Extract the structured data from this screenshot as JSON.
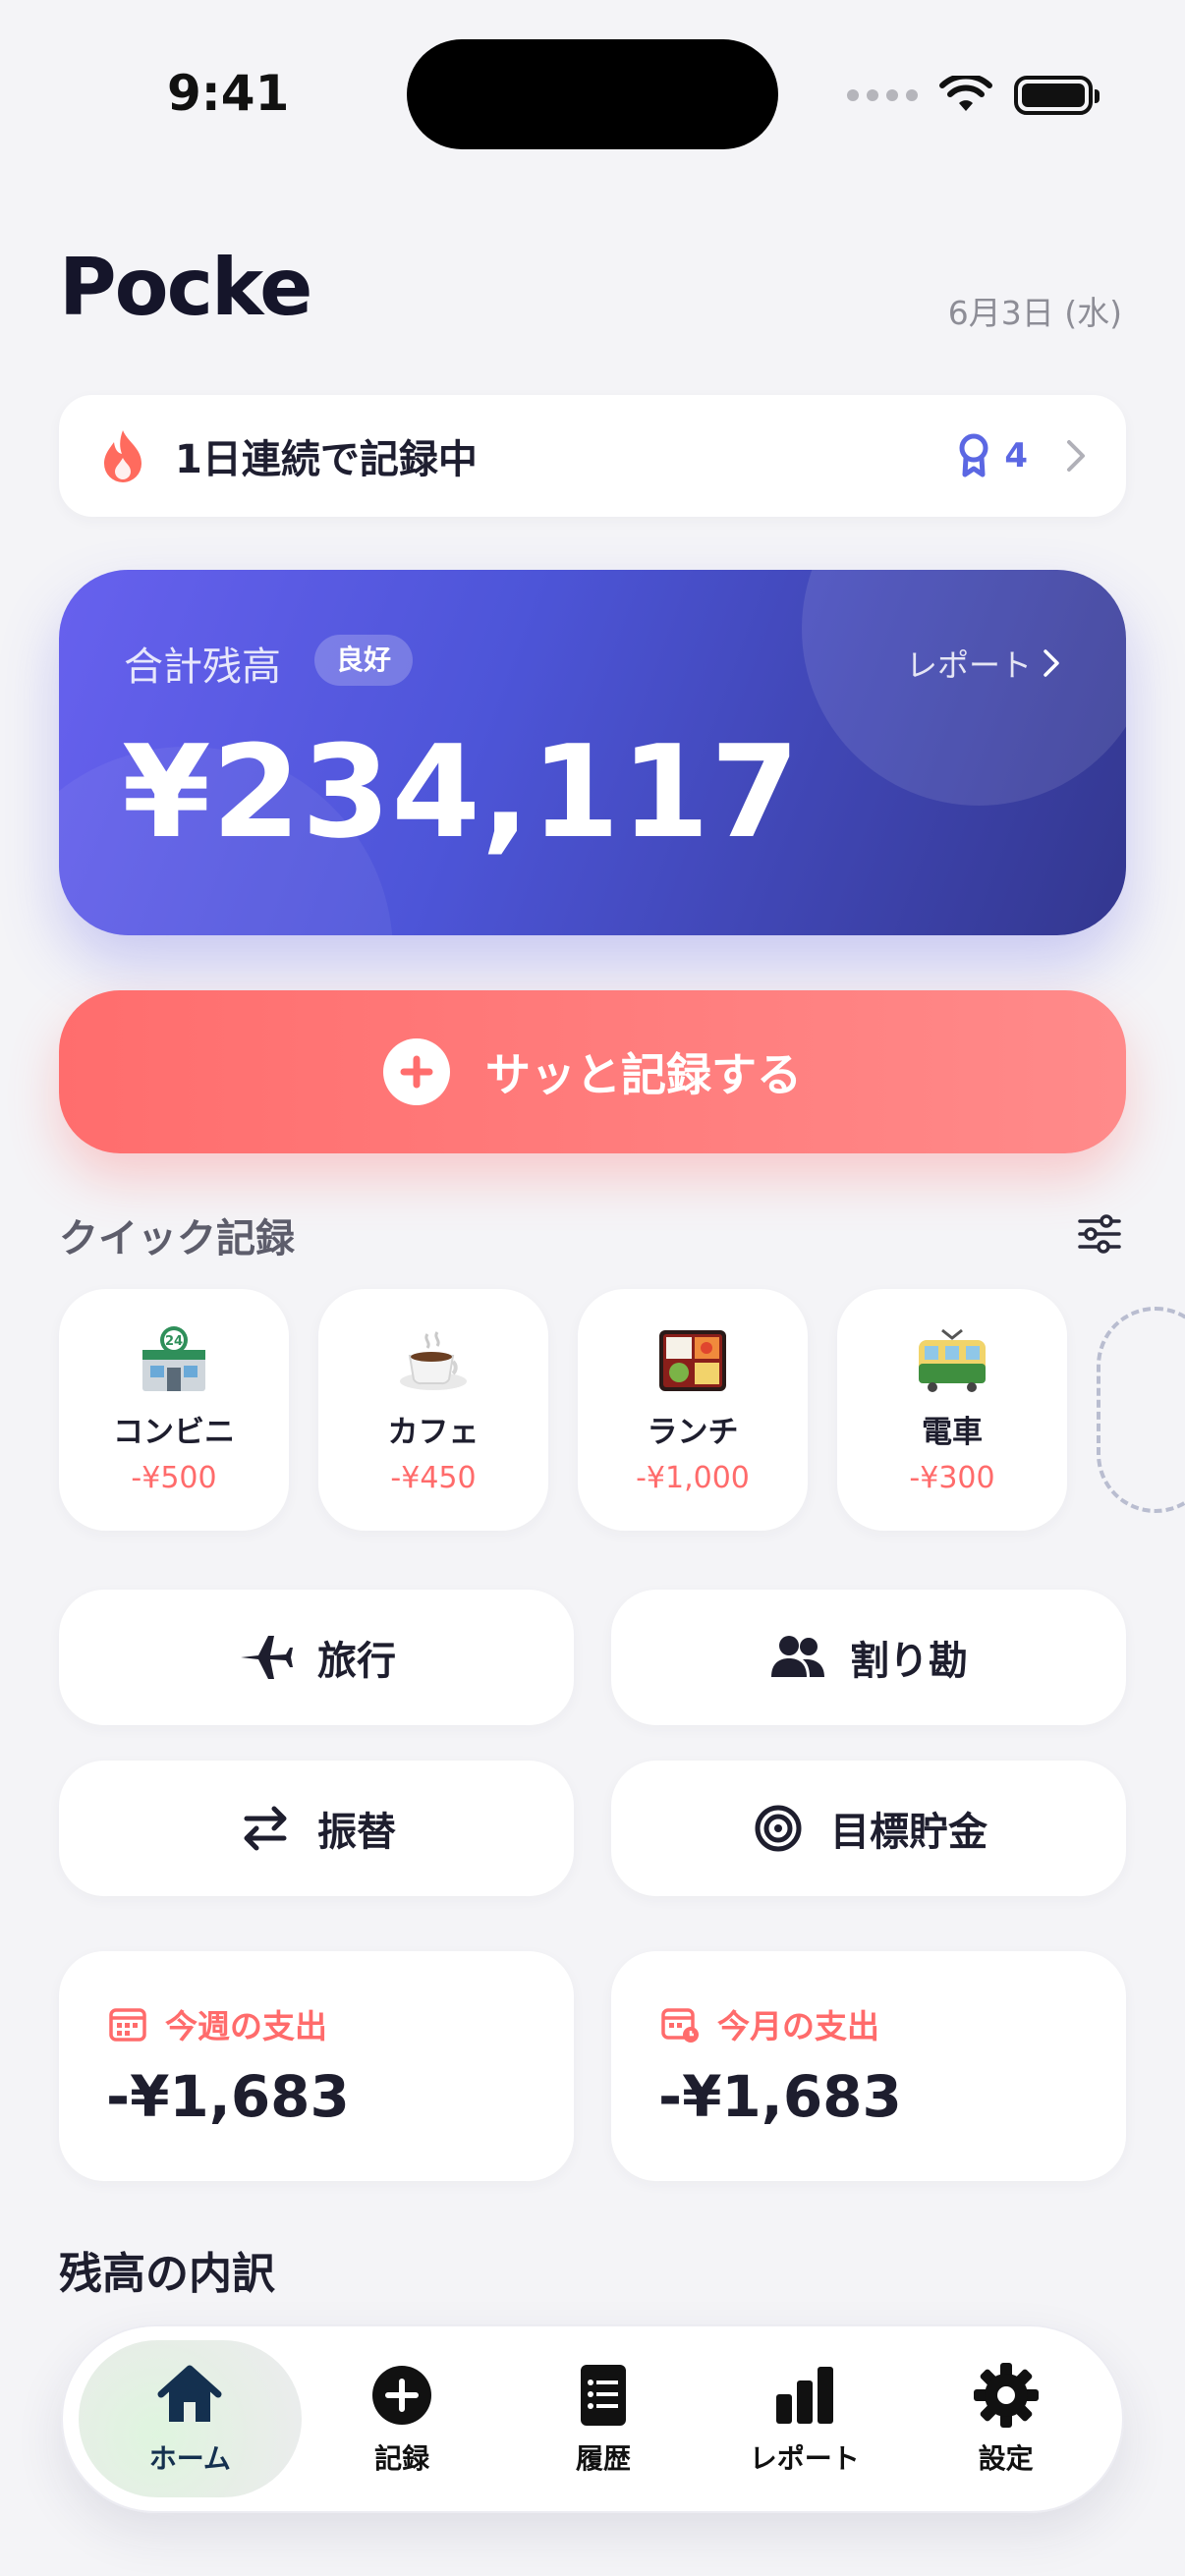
{
  "status_bar": {
    "time": "9:41"
  },
  "header": {
    "app_name": "Pocke",
    "date": "6月3日 (水)"
  },
  "streak": {
    "label": "1日連続で記録中",
    "badge_count": "4"
  },
  "balance": {
    "label": "合計残高",
    "status_badge": "良好",
    "report_link": "レポート",
    "amount": "¥234,117"
  },
  "primary_action": {
    "label": "サッと記録する"
  },
  "quick_record": {
    "title": "クイック記録",
    "items": [
      {
        "name": "コンビニ",
        "price": "-¥500",
        "icon": "convenience-store-icon"
      },
      {
        "name": "カフェ",
        "price": "-¥450",
        "icon": "coffee-cup-icon"
      },
      {
        "name": "ランチ",
        "price": "-¥1,000",
        "icon": "bento-box-icon"
      },
      {
        "name": "電車",
        "price": "-¥300",
        "icon": "train-icon"
      }
    ]
  },
  "features": [
    {
      "label": "旅行",
      "icon": "airplane-icon"
    },
    {
      "label": "割り勘",
      "icon": "people-icon"
    },
    {
      "label": "振替",
      "icon": "transfer-arrows-icon"
    },
    {
      "label": "目標貯金",
      "icon": "target-icon"
    }
  ],
  "spending": {
    "week": {
      "label": "今週の支出",
      "amount": "-¥1,683"
    },
    "month": {
      "label": "今月の支出",
      "amount": "-¥1,683"
    }
  },
  "breakdown": {
    "title": "残高の内訳"
  },
  "tabbar": {
    "items": [
      {
        "label": "ホーム",
        "icon": "home-icon",
        "active": true
      },
      {
        "label": "記録",
        "icon": "plus-circle-icon"
      },
      {
        "label": "履歴",
        "icon": "list-icon"
      },
      {
        "label": "レポート",
        "icon": "bar-chart-icon"
      },
      {
        "label": "設定",
        "icon": "gear-icon"
      }
    ]
  },
  "colors": {
    "accent": "#5b67e3",
    "record": "#ff6d6d",
    "expense": "#ff6b6b",
    "card_start": "#6761ee",
    "card_end": "#33378f"
  }
}
